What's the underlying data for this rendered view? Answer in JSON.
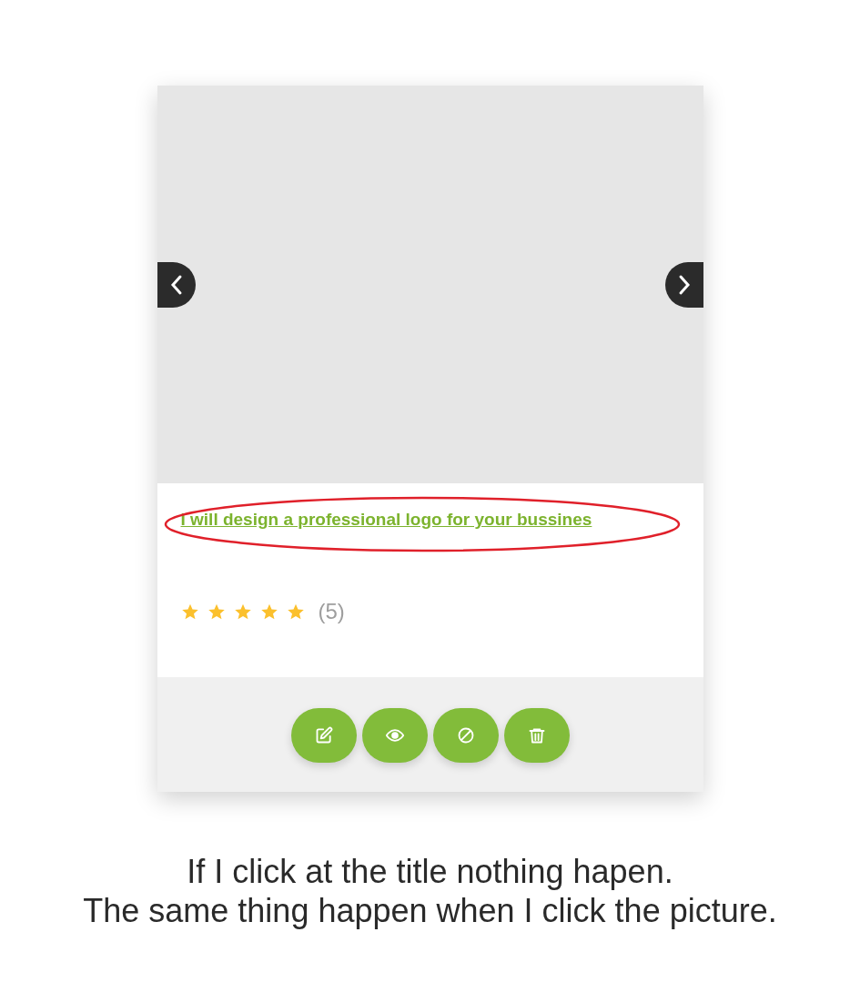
{
  "card": {
    "title": "I will design a professional logo for your bussines",
    "stars": 5,
    "rating_count": "(5)",
    "actions": [
      {
        "kind": "edit"
      },
      {
        "kind": "view"
      },
      {
        "kind": "disable"
      },
      {
        "kind": "delete"
      }
    ]
  },
  "caption": [
    "If I click at the title nothing hapen.",
    "The same thing happen when I click the picture."
  ]
}
